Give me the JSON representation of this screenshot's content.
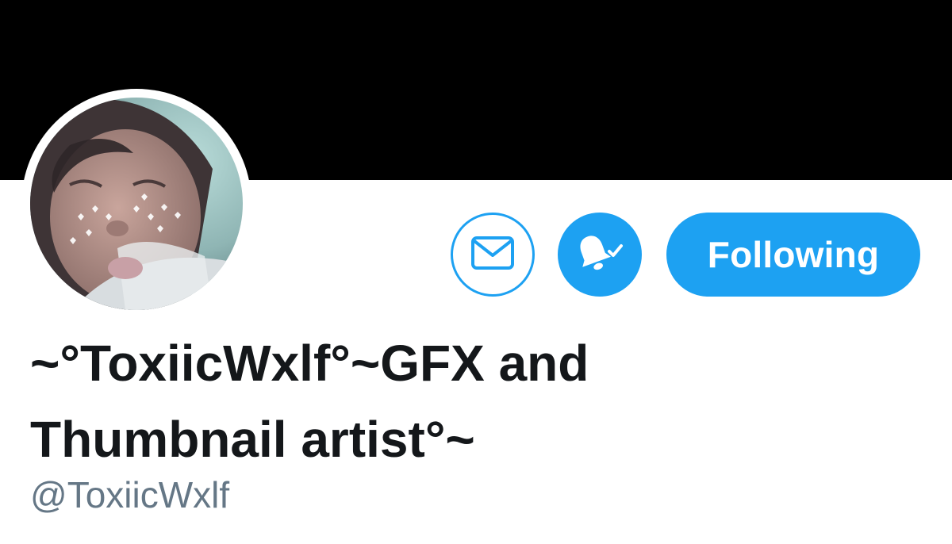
{
  "profile": {
    "display_name_line1": "~°ToxiicWxlf°~GFX and",
    "display_name_line2": "Thumbnail artist°~",
    "handle": "@ToxiicWxlf"
  },
  "actions": {
    "message_icon": "envelope-icon",
    "notify_icon": "bell-check-icon",
    "following_label": "Following"
  },
  "colors": {
    "accent": "#1da1f2",
    "banner": "#000000",
    "name_text": "#14171a",
    "handle_text": "#657786"
  }
}
